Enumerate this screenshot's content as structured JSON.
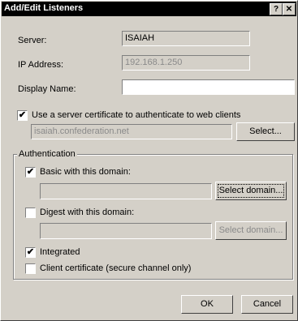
{
  "title": "Add/Edit Listeners",
  "titlebar": {
    "help": "?",
    "close": "✕"
  },
  "server": {
    "label": "Server:",
    "value": "ISAIAH"
  },
  "ip": {
    "label": "IP Address:",
    "value": "192.168.1.250"
  },
  "display_name": {
    "label": "Display Name:",
    "value": ""
  },
  "use_cert": {
    "label": "Use a server certificate to authenticate to web clients",
    "checked": "✔"
  },
  "cert": {
    "value": "isaiah.confederation.net",
    "select_label": "Select..."
  },
  "auth": {
    "legend": "Authentication",
    "basic": {
      "label": "Basic with this domain:",
      "checked": "✔",
      "value": "",
      "button": "Select domain..."
    },
    "digest": {
      "label": "Digest with this domain:",
      "checked": "",
      "value": "",
      "button": "Select domain..."
    },
    "integrated": {
      "label": "Integrated",
      "checked": "✔"
    },
    "client_cert": {
      "label": "Client certificate (secure channel only)",
      "checked": ""
    }
  },
  "footer": {
    "ok": "OK",
    "cancel": "Cancel"
  }
}
